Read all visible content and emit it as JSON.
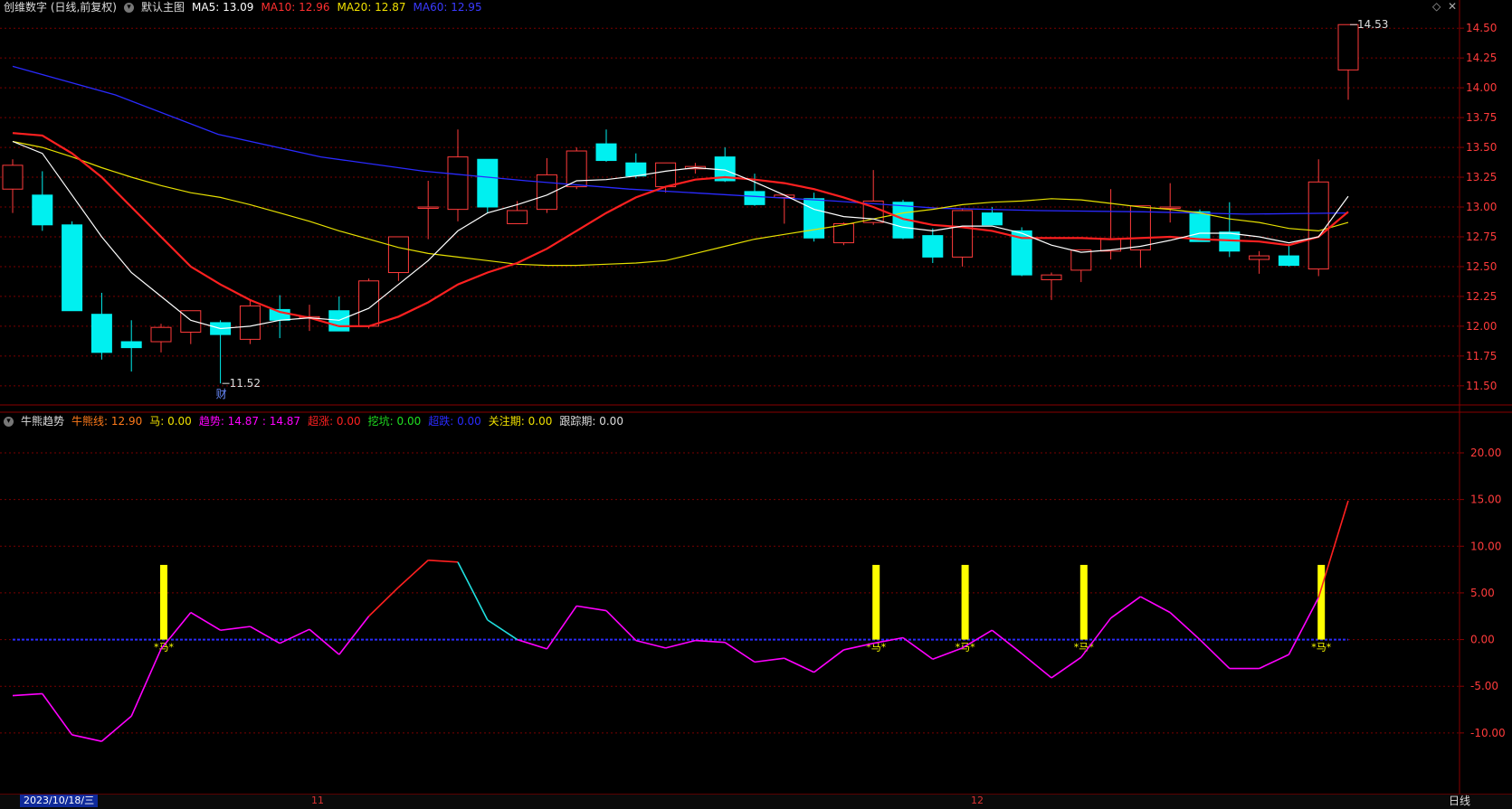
{
  "header": {
    "stock": "创维数字 (日线,前复权)",
    "template": "默认主图",
    "ma5": "MA5: 13.09",
    "ma10": "MA10: 12.96",
    "ma20": "MA20: 12.87",
    "ma60": "MA60: 12.95"
  },
  "indicator_header": {
    "name": "牛熊趋势",
    "line": "牛熊线: 12.90",
    "ma": "马: 0.00",
    "trend": "趋势: 14.87 : 14.87",
    "surge": "超涨: 0.00",
    "pit": "挖坑: 0.00",
    "oversold": "超跌: 0.00",
    "watch": "关注期: 0.00",
    "track": "跟踪期: 0.00"
  },
  "colors": {
    "up": "#ff3b3b",
    "down": "#00f0f0",
    "ma5": "#ffffff",
    "ma10": "#ff2020",
    "ma20": "#e6e000",
    "ma60": "#2a2aff",
    "grid": "#7a0000",
    "trend": "#ff00ff",
    "marker": "#ffff00"
  },
  "bottom": {
    "date": "2023/10/18/三",
    "month_11": "11",
    "month_12": "12",
    "period": "日线"
  },
  "chart_data": [
    {
      "type": "candlestick",
      "ylim": [
        11.4,
        14.6
      ],
      "yticks": [
        "14.50",
        "14.25",
        "14.00",
        "13.75",
        "13.50",
        "13.25",
        "13.00",
        "12.75",
        "12.50",
        "12.25",
        "12.00",
        "11.75",
        "11.50"
      ],
      "annotations": {
        "low": "11.52",
        "high": "14.53",
        "event": "财"
      },
      "candles": [
        {
          "o": 13.15,
          "h": 13.4,
          "l": 12.95,
          "c": 13.35
        },
        {
          "o": 13.1,
          "h": 13.3,
          "l": 12.8,
          "c": 12.85
        },
        {
          "o": 12.85,
          "h": 12.88,
          "l": 12.13,
          "c": 12.13
        },
        {
          "o": 12.1,
          "h": 12.28,
          "l": 11.72,
          "c": 11.78
        },
        {
          "o": 11.87,
          "h": 12.05,
          "l": 11.62,
          "c": 11.82
        },
        {
          "o": 11.87,
          "h": 12.02,
          "l": 11.78,
          "c": 11.99
        },
        {
          "o": 11.95,
          "h": 12.13,
          "l": 11.85,
          "c": 12.13
        },
        {
          "o": 12.03,
          "h": 12.05,
          "l": 11.52,
          "c": 11.93
        },
        {
          "o": 11.89,
          "h": 12.22,
          "l": 11.85,
          "c": 12.17
        },
        {
          "o": 12.14,
          "h": 12.26,
          "l": 11.9,
          "c": 12.05
        },
        {
          "o": 12.08,
          "h": 12.18,
          "l": 11.96,
          "c": 12.08
        },
        {
          "o": 12.13,
          "h": 12.25,
          "l": 11.96,
          "c": 11.96
        },
        {
          "o": 12.0,
          "h": 12.4,
          "l": 11.98,
          "c": 12.38
        },
        {
          "o": 12.45,
          "h": 12.75,
          "l": 12.38,
          "c": 12.75
        },
        {
          "o": 13.0,
          "h": 13.22,
          "l": 12.73,
          "c": 13.0
        },
        {
          "o": 12.98,
          "h": 13.65,
          "l": 12.88,
          "c": 13.42
        },
        {
          "o": 13.4,
          "h": 13.4,
          "l": 12.95,
          "c": 13.0
        },
        {
          "o": 12.86,
          "h": 13.05,
          "l": 12.86,
          "c": 12.97
        },
        {
          "o": 12.98,
          "h": 13.41,
          "l": 12.95,
          "c": 13.27
        },
        {
          "o": 13.17,
          "h": 13.5,
          "l": 13.15,
          "c": 13.47
        },
        {
          "o": 13.53,
          "h": 13.65,
          "l": 13.38,
          "c": 13.39
        },
        {
          "o": 13.37,
          "h": 13.45,
          "l": 13.24,
          "c": 13.26
        },
        {
          "o": 13.17,
          "h": 13.37,
          "l": 13.12,
          "c": 13.37
        },
        {
          "o": 13.32,
          "h": 13.37,
          "l": 13.28,
          "c": 13.34
        },
        {
          "o": 13.42,
          "h": 13.5,
          "l": 13.21,
          "c": 13.22
        },
        {
          "o": 13.13,
          "h": 13.28,
          "l": 13.01,
          "c": 13.02
        },
        {
          "o": 13.08,
          "h": 13.11,
          "l": 12.86,
          "c": 13.1
        },
        {
          "o": 13.07,
          "h": 13.12,
          "l": 12.71,
          "c": 12.74
        },
        {
          "o": 12.7,
          "h": 12.87,
          "l": 12.68,
          "c": 12.86
        },
        {
          "o": 12.87,
          "h": 13.31,
          "l": 12.85,
          "c": 13.05
        },
        {
          "o": 13.04,
          "h": 13.06,
          "l": 12.73,
          "c": 12.74
        },
        {
          "o": 12.76,
          "h": 12.82,
          "l": 12.53,
          "c": 12.58
        },
        {
          "o": 12.58,
          "h": 12.99,
          "l": 12.5,
          "c": 12.97
        },
        {
          "o": 12.95,
          "h": 13.0,
          "l": 12.86,
          "c": 12.85
        },
        {
          "o": 12.8,
          "h": 12.83,
          "l": 12.42,
          "c": 12.43
        },
        {
          "o": 12.39,
          "h": 12.45,
          "l": 12.22,
          "c": 12.43
        },
        {
          "o": 12.47,
          "h": 12.6,
          "l": 12.37,
          "c": 12.64
        },
        {
          "o": 12.63,
          "h": 13.15,
          "l": 12.56,
          "c": 12.73
        },
        {
          "o": 12.64,
          "h": 13.01,
          "l": 12.49,
          "c": 13.01
        },
        {
          "o": 13.0,
          "h": 13.2,
          "l": 12.87,
          "c": 13.0
        },
        {
          "o": 12.96,
          "h": 12.98,
          "l": 12.71,
          "c": 12.71
        },
        {
          "o": 12.79,
          "h": 13.04,
          "l": 12.58,
          "c": 12.63
        },
        {
          "o": 12.56,
          "h": 12.63,
          "l": 12.44,
          "c": 12.59
        },
        {
          "o": 12.59,
          "h": 12.69,
          "l": 12.5,
          "c": 12.51
        },
        {
          "o": 12.48,
          "h": 13.4,
          "l": 12.42,
          "c": 13.21
        },
        {
          "o": 14.15,
          "h": 14.53,
          "l": 13.9,
          "c": 14.53
        }
      ],
      "ma5": [
        13.55,
        13.45,
        13.1,
        12.75,
        12.45,
        12.25,
        12.05,
        11.98,
        12.0,
        12.05,
        12.07,
        12.05,
        12.15,
        12.35,
        12.55,
        12.8,
        12.95,
        13.02,
        13.1,
        13.22,
        13.23,
        13.26,
        13.3,
        13.33,
        13.31,
        13.21,
        13.1,
        12.98,
        12.92,
        12.9,
        12.83,
        12.8,
        12.84,
        12.84,
        12.78,
        12.68,
        12.62,
        12.64,
        12.67,
        12.72,
        12.78,
        12.78,
        12.75,
        12.7,
        12.75,
        13.09
      ],
      "ma10": [
        13.62,
        13.6,
        13.45,
        13.25,
        13.0,
        12.75,
        12.5,
        12.35,
        12.22,
        12.12,
        12.07,
        12.0,
        12.0,
        12.08,
        12.2,
        12.35,
        12.45,
        12.53,
        12.65,
        12.8,
        12.95,
        13.08,
        13.17,
        13.23,
        13.25,
        13.23,
        13.2,
        13.15,
        13.08,
        13.0,
        12.9,
        12.85,
        12.83,
        12.8,
        12.74,
        12.74,
        12.74,
        12.73,
        12.74,
        12.75,
        12.73,
        12.72,
        12.71,
        12.68,
        12.75,
        12.96
      ],
      "ma20": [
        13.55,
        13.5,
        13.42,
        13.33,
        13.25,
        13.18,
        13.12,
        13.08,
        13.02,
        12.95,
        12.88,
        12.8,
        12.73,
        12.66,
        12.61,
        12.58,
        12.55,
        12.52,
        12.51,
        12.51,
        12.52,
        12.53,
        12.55,
        12.61,
        12.67,
        12.73,
        12.77,
        12.81,
        12.85,
        12.9,
        12.95,
        12.98,
        13.02,
        13.04,
        13.05,
        13.07,
        13.06,
        13.03,
        13.0,
        12.98,
        12.95,
        12.9,
        12.87,
        12.82,
        12.8,
        12.87
      ],
      "ma60": {
        "x": [
          0,
          7,
          14,
          21,
          28,
          35,
          42,
          45
        ],
        "y": [
          14.18,
          13.94,
          13.61,
          13.42,
          13.3,
          13.22,
          13.15,
          13.1,
          13.05,
          12.99,
          12.97,
          12.96,
          12.94,
          12.95
        ]
      }
    },
    {
      "type": "line",
      "name": "牛熊趋势",
      "ylim": [
        -16.5,
        23
      ],
      "yticks": [
        "20.00",
        "15.00",
        "10.00",
        "5.00",
        "0.00",
        "-5.00",
        "-10.00"
      ],
      "trend": [
        -6.0,
        -5.8,
        -10.2,
        -10.9,
        -8.2,
        -1.0,
        2.9,
        1.0,
        1.4,
        -0.4,
        1.1,
        -1.6,
        2.5,
        5.6,
        8.5,
        8.3,
        2.1,
        0.0,
        -1.0,
        3.6,
        3.1,
        -0.1,
        -0.9,
        -0.1,
        -0.3,
        -2.4,
        -2.0,
        -3.5,
        -1.1,
        -0.4,
        0.2,
        -2.1,
        -0.9,
        1.0,
        -1.5,
        -4.1,
        -1.9,
        2.3,
        4.6,
        2.9,
        0.0,
        -3.1,
        -3.1,
        -1.6,
        4.5,
        14.87
      ],
      "ma_bars": [
        5,
        29,
        32,
        36,
        44
      ],
      "ma_value": 8.0,
      "ma_label": "*马*"
    }
  ]
}
